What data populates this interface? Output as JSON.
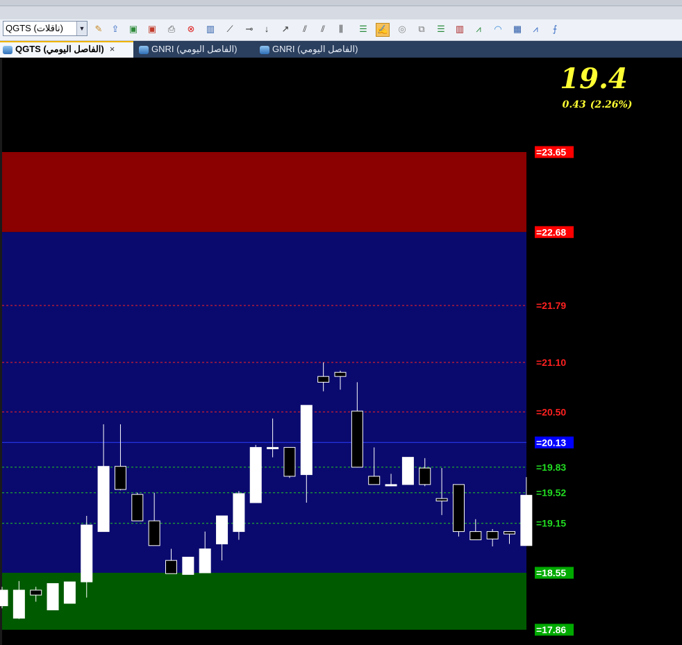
{
  "toolbar": {
    "symbol": "QGTS (ناقلات)",
    "icons": [
      "wand-icon",
      "export-icon",
      "add-chart-icon",
      "remove-chart-icon",
      "print-icon",
      "delete-icon",
      "indicator-icon",
      "trendline-icon",
      "horizontal-line-icon",
      "vertical-line-icon",
      "ray-icon",
      "channel-icon",
      "parallel-lines-icon",
      "vertical-lines-icon",
      "levels-icon",
      "brush-icon",
      "circle-icon",
      "copy-icon",
      "list-icon",
      "bars-icon",
      "fan-icon",
      "arc-icon",
      "grid-icon",
      "gann-icon",
      "fib-icon"
    ]
  },
  "tabs": [
    {
      "label": "QGTS (الفاصل اليومي)",
      "active": true,
      "close": "×"
    },
    {
      "label": "GNRI (الفاصل اليومي)",
      "active": false
    },
    {
      "label": "GNRI (الفاصل اليومي)",
      "active": false
    }
  ],
  "quote": {
    "last": "19.4",
    "change": "0.43",
    "change_pct": "(2.26%)",
    "color": "#ffff33"
  },
  "chart_data": {
    "type": "candlestick",
    "ylim": [
      17.7,
      23.9
    ],
    "zones": [
      {
        "from": 22.68,
        "to": 23.65,
        "color": "#8b0000"
      },
      {
        "from": 18.55,
        "to": 22.68,
        "color": "#0a0a6e"
      },
      {
        "from": 17.86,
        "to": 18.55,
        "color": "#005a00"
      }
    ],
    "levels": [
      {
        "label": "=23.65",
        "value": 23.65,
        "bg": "#ff0000",
        "fg": "#ffffff",
        "line": false
      },
      {
        "label": "=22.68",
        "value": 22.68,
        "bg": "#ff0000",
        "fg": "#ffffff",
        "line": false
      },
      {
        "label": "=21.79",
        "value": 21.79,
        "bg": "",
        "fg": "#ff2020",
        "line": true,
        "lineColor": "#ff2020"
      },
      {
        "label": "=21.10",
        "value": 21.1,
        "bg": "",
        "fg": "#ff2020",
        "line": true,
        "lineColor": "#ff2020"
      },
      {
        "label": "=20.50",
        "value": 20.5,
        "bg": "",
        "fg": "#ff2020",
        "line": true,
        "lineColor": "#ff2020"
      },
      {
        "label": "=20.13",
        "value": 20.13,
        "bg": "#0000ff",
        "fg": "#ffffff",
        "line": true,
        "lineColor": "#2a3cff",
        "solid": true
      },
      {
        "label": "=19.83",
        "value": 19.83,
        "bg": "",
        "fg": "#22dd22",
        "line": true,
        "lineColor": "#22cc22"
      },
      {
        "label": "=19.52",
        "value": 19.52,
        "bg": "",
        "fg": "#22dd22",
        "line": true,
        "lineColor": "#22cc22"
      },
      {
        "label": "=19.15",
        "value": 19.15,
        "bg": "",
        "fg": "#22dd22",
        "line": true,
        "lineColor": "#22cc22"
      },
      {
        "label": "=18.55",
        "value": 18.55,
        "bg": "#00aa00",
        "fg": "#ffffff",
        "line": false
      },
      {
        "label": "=17.86",
        "value": 17.86,
        "bg": "#00aa00",
        "fg": "#ffffff",
        "line": false
      }
    ],
    "candles": [
      {
        "o": 18.15,
        "h": 18.38,
        "l": 18.12,
        "c": 18.34
      },
      {
        "o": 18.0,
        "h": 18.45,
        "l": 17.99,
        "c": 18.34
      },
      {
        "o": 18.34,
        "h": 18.38,
        "l": 18.2,
        "c": 18.28
      },
      {
        "o": 18.1,
        "h": 18.42,
        "l": 18.1,
        "c": 18.42
      },
      {
        "o": 18.18,
        "h": 18.44,
        "l": 18.18,
        "c": 18.44
      },
      {
        "o": 18.44,
        "h": 19.24,
        "l": 18.25,
        "c": 19.13
      },
      {
        "o": 19.05,
        "h": 20.35,
        "l": 19.05,
        "c": 19.84
      },
      {
        "o": 19.84,
        "h": 20.35,
        "l": 19.55,
        "c": 19.56
      },
      {
        "o": 19.5,
        "h": 19.52,
        "l": 19.18,
        "c": 19.18
      },
      {
        "o": 19.18,
        "h": 19.52,
        "l": 18.88,
        "c": 18.88
      },
      {
        "o": 18.7,
        "h": 18.84,
        "l": 18.54,
        "c": 18.54
      },
      {
        "o": 18.53,
        "h": 18.74,
        "l": 18.53,
        "c": 18.74
      },
      {
        "o": 18.55,
        "h": 19.05,
        "l": 18.55,
        "c": 18.84
      },
      {
        "o": 18.9,
        "h": 19.23,
        "l": 18.7,
        "c": 19.24
      },
      {
        "o": 19.05,
        "h": 19.54,
        "l": 18.95,
        "c": 19.51
      },
      {
        "o": 19.4,
        "h": 20.1,
        "l": 19.4,
        "c": 20.07
      },
      {
        "o": 20.06,
        "h": 20.42,
        "l": 19.95,
        "c": 20.07
      },
      {
        "o": 20.07,
        "h": 20.07,
        "l": 19.7,
        "c": 19.72
      },
      {
        "o": 19.74,
        "h": 20.58,
        "l": 19.4,
        "c": 20.58
      },
      {
        "o": 20.93,
        "h": 21.1,
        "l": 20.75,
        "c": 20.86
      },
      {
        "o": 20.98,
        "h": 21.0,
        "l": 20.77,
        "c": 20.93
      },
      {
        "o": 20.51,
        "h": 20.86,
        "l": 19.83,
        "c": 19.83
      },
      {
        "o": 19.72,
        "h": 20.07,
        "l": 19.62,
        "c": 19.62
      },
      {
        "o": 19.62,
        "h": 19.75,
        "l": 19.6,
        "c": 19.62
      },
      {
        "o": 19.62,
        "h": 19.95,
        "l": 19.62,
        "c": 19.95
      },
      {
        "o": 19.82,
        "h": 19.94,
        "l": 19.6,
        "c": 19.62
      },
      {
        "o": 19.45,
        "h": 19.82,
        "l": 19.25,
        "c": 19.42
      },
      {
        "o": 19.62,
        "h": 19.62,
        "l": 18.99,
        "c": 19.05
      },
      {
        "o": 19.05,
        "h": 19.2,
        "l": 18.96,
        "c": 18.95
      },
      {
        "o": 19.05,
        "h": 19.08,
        "l": 18.87,
        "c": 18.96
      },
      {
        "o": 19.05,
        "h": 19.05,
        "l": 18.9,
        "c": 19.02
      },
      {
        "o": 18.88,
        "h": 19.71,
        "l": 18.88,
        "c": 19.49
      }
    ]
  }
}
